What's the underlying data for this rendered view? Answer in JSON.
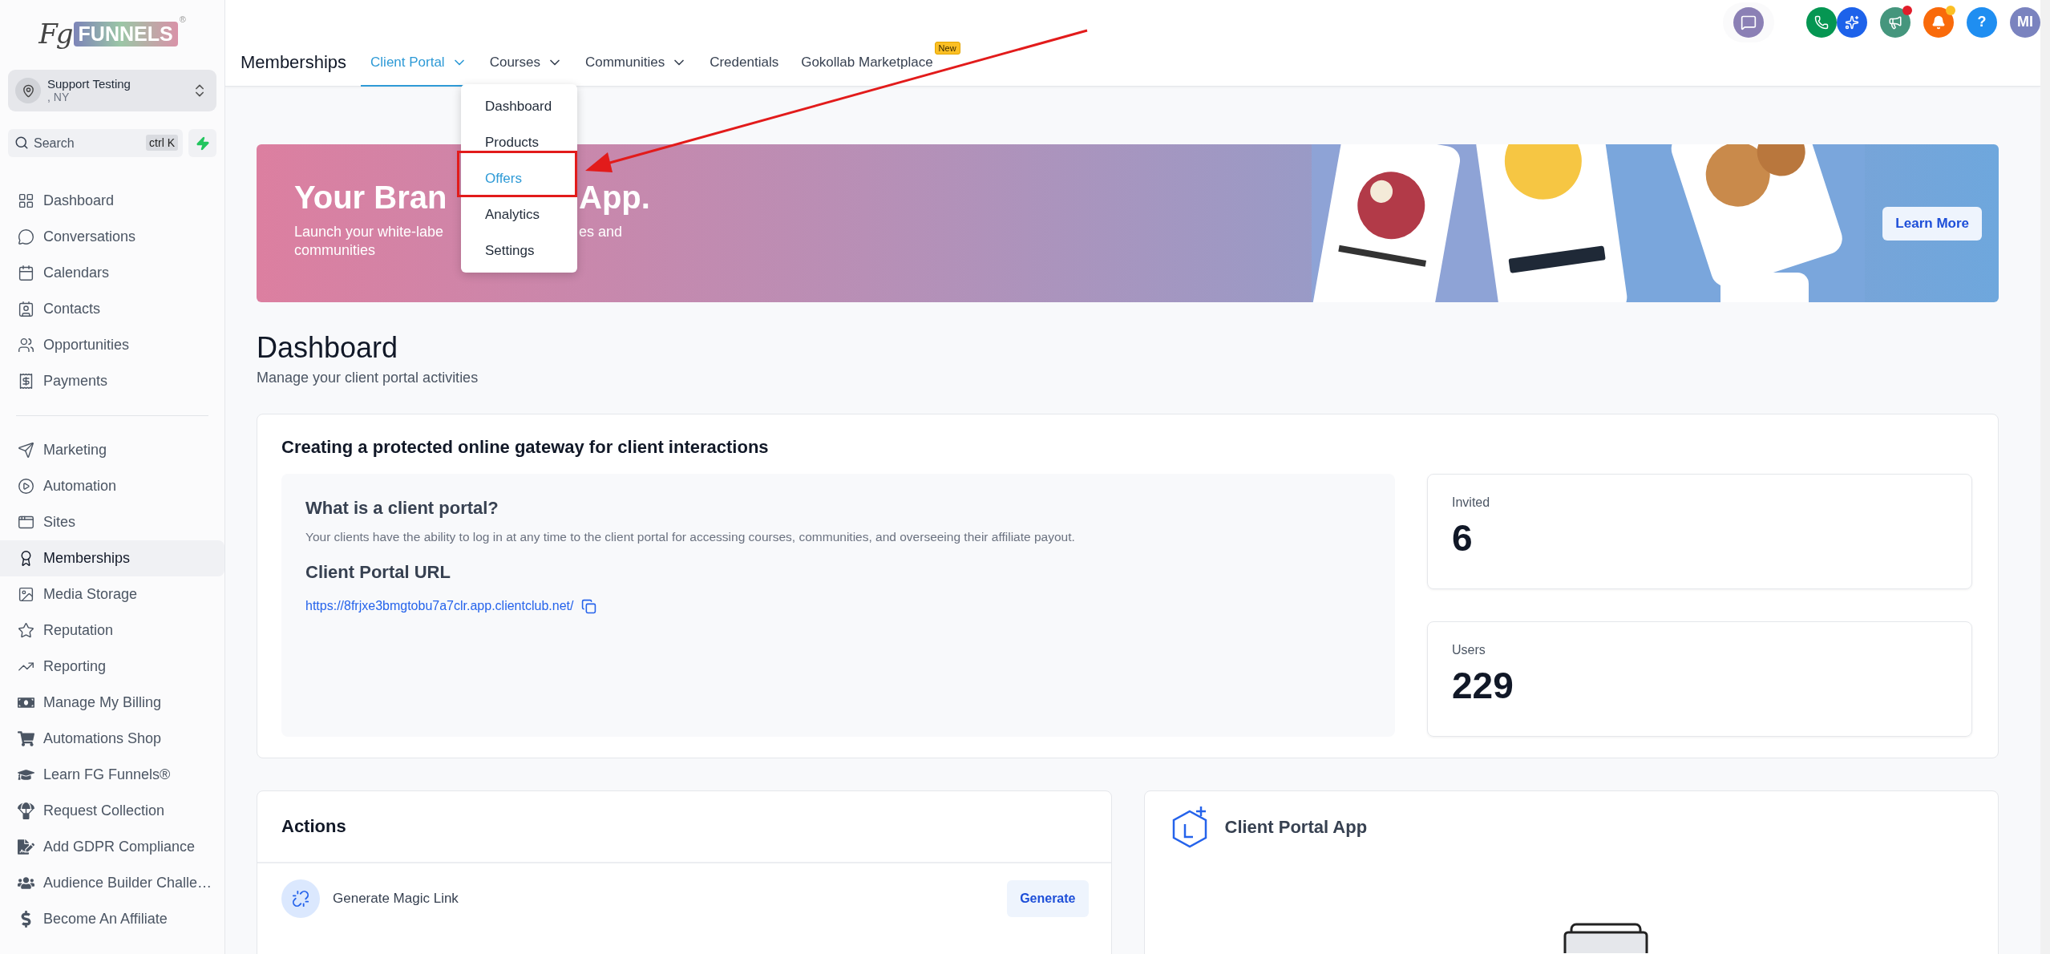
{
  "sidebar": {
    "logo": {
      "script": "Fg",
      "wordmark": "FUNNELS",
      "mark": "®"
    },
    "account": {
      "name": "Support Testing",
      "location": ", NY"
    },
    "search": {
      "placeholder": "Search",
      "shortcut": "ctrl K"
    },
    "groups": [
      {
        "items": [
          {
            "label": "Dashboard",
            "selected": false
          },
          {
            "label": "Conversations",
            "selected": false
          },
          {
            "label": "Calendars",
            "selected": false
          },
          {
            "label": "Contacts",
            "selected": false
          },
          {
            "label": "Opportunities",
            "selected": false
          },
          {
            "label": "Payments",
            "selected": false
          }
        ]
      },
      {
        "items": [
          {
            "label": "Marketing",
            "selected": false
          },
          {
            "label": "Automation",
            "selected": false
          },
          {
            "label": "Sites",
            "selected": false
          },
          {
            "label": "Memberships",
            "selected": true
          },
          {
            "label": "Media Storage",
            "selected": false
          },
          {
            "label": "Reputation",
            "selected": false
          },
          {
            "label": "Reporting",
            "selected": false
          },
          {
            "label": "Manage My Billing",
            "selected": false
          },
          {
            "label": "Automations Shop",
            "selected": false
          },
          {
            "label": "Learn FG Funnels®",
            "selected": false
          },
          {
            "label": "Request Collection",
            "selected": false
          },
          {
            "label": "Add GDPR Compliance",
            "selected": false
          },
          {
            "label": "Audience Builder Challe…",
            "selected": false
          },
          {
            "label": "Become An Affiliate",
            "selected": false
          }
        ]
      }
    ]
  },
  "topbar": {
    "title": "Memberships",
    "tabs": [
      {
        "label": "Client Portal",
        "has_menu": true,
        "selected": true
      },
      {
        "label": "Courses",
        "has_menu": true,
        "selected": false
      },
      {
        "label": "Communities",
        "has_menu": true,
        "selected": false
      },
      {
        "label": "Credentials",
        "has_menu": false,
        "selected": false
      },
      {
        "label": "Gokollab Marketplace",
        "has_menu": false,
        "selected": false,
        "badge": "New"
      }
    ],
    "menu": {
      "items": [
        {
          "label": "Dashboard",
          "selected": false
        },
        {
          "label": "Products",
          "selected": false
        },
        {
          "label": "Offers",
          "selected": true
        },
        {
          "label": "Analytics",
          "selected": false
        },
        {
          "label": "Settings",
          "selected": false
        }
      ]
    },
    "help_label": "?",
    "avatar": "MI"
  },
  "banner": {
    "title": [
      "Your Bran",
      "App."
    ],
    "lines": [
      [
        "Launch your white-labe",
        "es and"
      ],
      [
        "communities"
      ]
    ],
    "button": "Learn More"
  },
  "dashboard": {
    "title": "Dashboard",
    "subtitle": "Manage your client portal activities"
  },
  "gateway": {
    "title": "Creating a protected online gateway for client interactions",
    "heading": "What is a client portal?",
    "description": "Your clients have the ability to log in at any time to the client portal for accessing courses, communities, and overseeing their affiliate payout.",
    "url_heading": "Client Portal URL",
    "url": "https://8frjxe3bmgtobu7a7clr.app.clientclub.net/",
    "stats": [
      {
        "label": "Invited",
        "value": "6"
      },
      {
        "label": "Users",
        "value": "229"
      }
    ]
  },
  "actions": {
    "title": "Actions",
    "items": [
      {
        "label": "Generate Magic Link",
        "button": "Generate"
      }
    ]
  },
  "app_card": {
    "title": "Client Portal App"
  }
}
